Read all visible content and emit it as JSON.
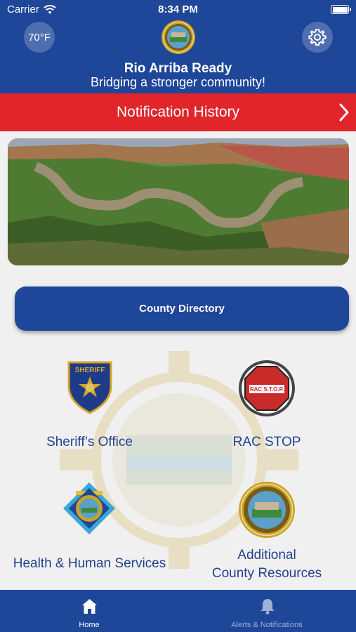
{
  "status_bar": {
    "carrier": "Carrier",
    "time": "8:34 PM"
  },
  "header": {
    "temperature": "70°F",
    "title": "Rio Arriba Ready",
    "subtitle": "Bridging a stronger community!"
  },
  "notification_bar": {
    "label": "Notification History"
  },
  "directory": {
    "label": "County Directory"
  },
  "tiles": [
    {
      "label": "Sheriff’s Office",
      "icon": "sheriff-badge-icon"
    },
    {
      "label": "RAC STOP",
      "icon": "rac-stop-icon"
    },
    {
      "label": "Health & Human Services",
      "icon": "health-services-icon"
    },
    {
      "label_line1": "Additional",
      "label_line2": "County Resources",
      "icon": "county-seal-icon"
    }
  ],
  "badges": {
    "sheriff": "SHERIFF",
    "rac_stop": "RAC S.T.O.P."
  },
  "tab_bar": {
    "home": "Home",
    "alerts": "Alerts & Notifications"
  },
  "colors": {
    "header_blue": "#1e4699",
    "alert_red": "#e0262a",
    "label_blue": "#23428f",
    "background": "#f0f0f0"
  }
}
